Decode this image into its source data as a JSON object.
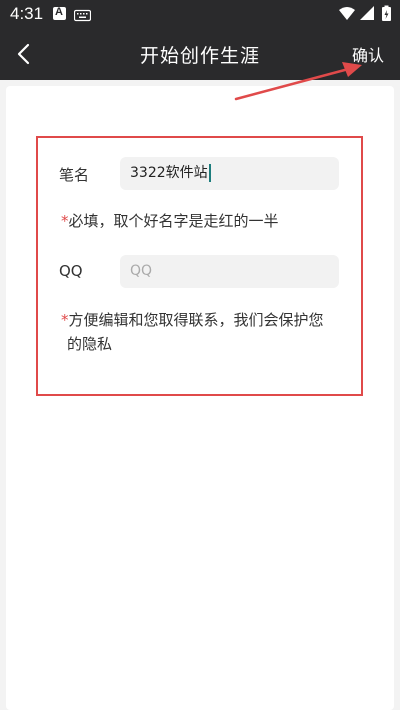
{
  "status_bar": {
    "time": "4:31",
    "notification_a": "A"
  },
  "header": {
    "title": "开始创作生涯",
    "confirm_label": "确认"
  },
  "form": {
    "pen_name": {
      "label": "笔名",
      "value": "3322软件站",
      "hint_star": "*",
      "hint": "必填，取个好名字是走红的一半"
    },
    "qq": {
      "label": "QQ",
      "placeholder": "QQ",
      "hint_star": "*",
      "hint_line1": "方便编辑和您取得联系，我们会保护您",
      "hint_line2": "的隐私"
    }
  },
  "colors": {
    "header_bg": "#2a2a2c",
    "annotation_red": "#e04a4a",
    "input_bg": "#f2f2f2",
    "cursor": "#1d7d7d"
  }
}
